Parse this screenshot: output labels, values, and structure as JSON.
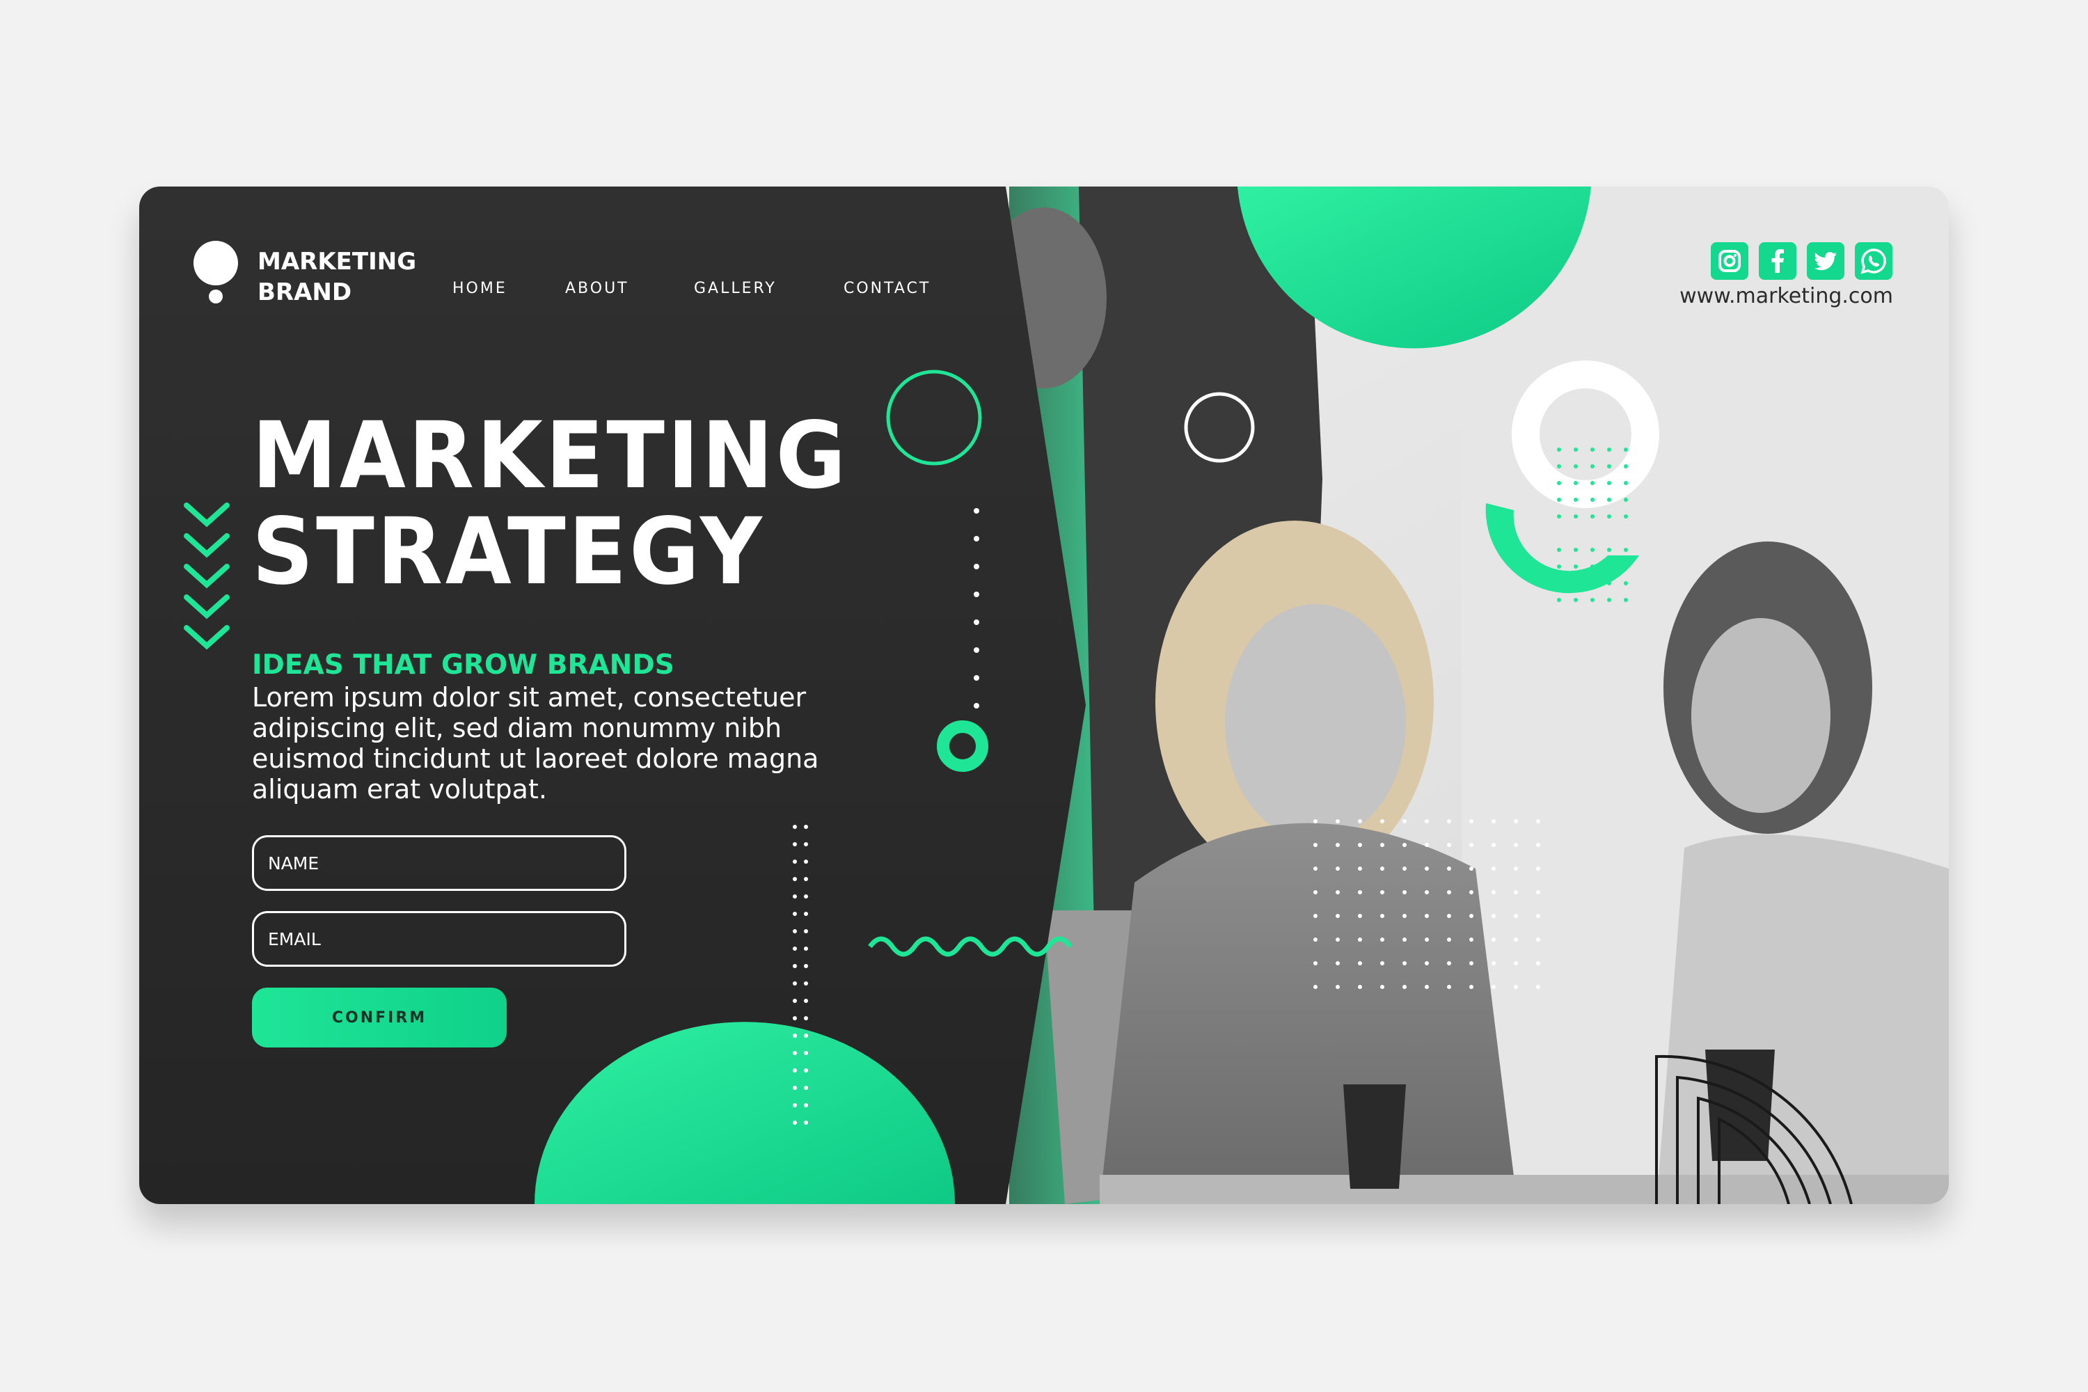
{
  "brand": {
    "line1": "MARKETING",
    "line2": "BRAND"
  },
  "nav": {
    "items": [
      "HOME",
      "ABOUT",
      "GALLERY",
      "CONTACT"
    ]
  },
  "hero": {
    "title_line1": "MARKETING",
    "title_line2": "STRATEGY",
    "subtitle": "IDEAS THAT GROW BRANDS",
    "body": "Lorem ipsum dolor sit amet, consectetuer adipiscing elit, sed diam nonummy nibh euismod tincidunt ut laoreet dolore magna aliquam erat volutpat."
  },
  "form": {
    "name_placeholder": "NAME",
    "email_placeholder": "EMAIL",
    "confirm_label": "CONFIRM"
  },
  "social": {
    "icons": [
      "instagram-icon",
      "facebook-icon",
      "twitter-icon",
      "whatsapp-icon"
    ]
  },
  "site_url": "www.marketing.com",
  "colors": {
    "accent": "#1fe597",
    "panel": "#2c2c2c",
    "background": "#f2f2f2"
  }
}
